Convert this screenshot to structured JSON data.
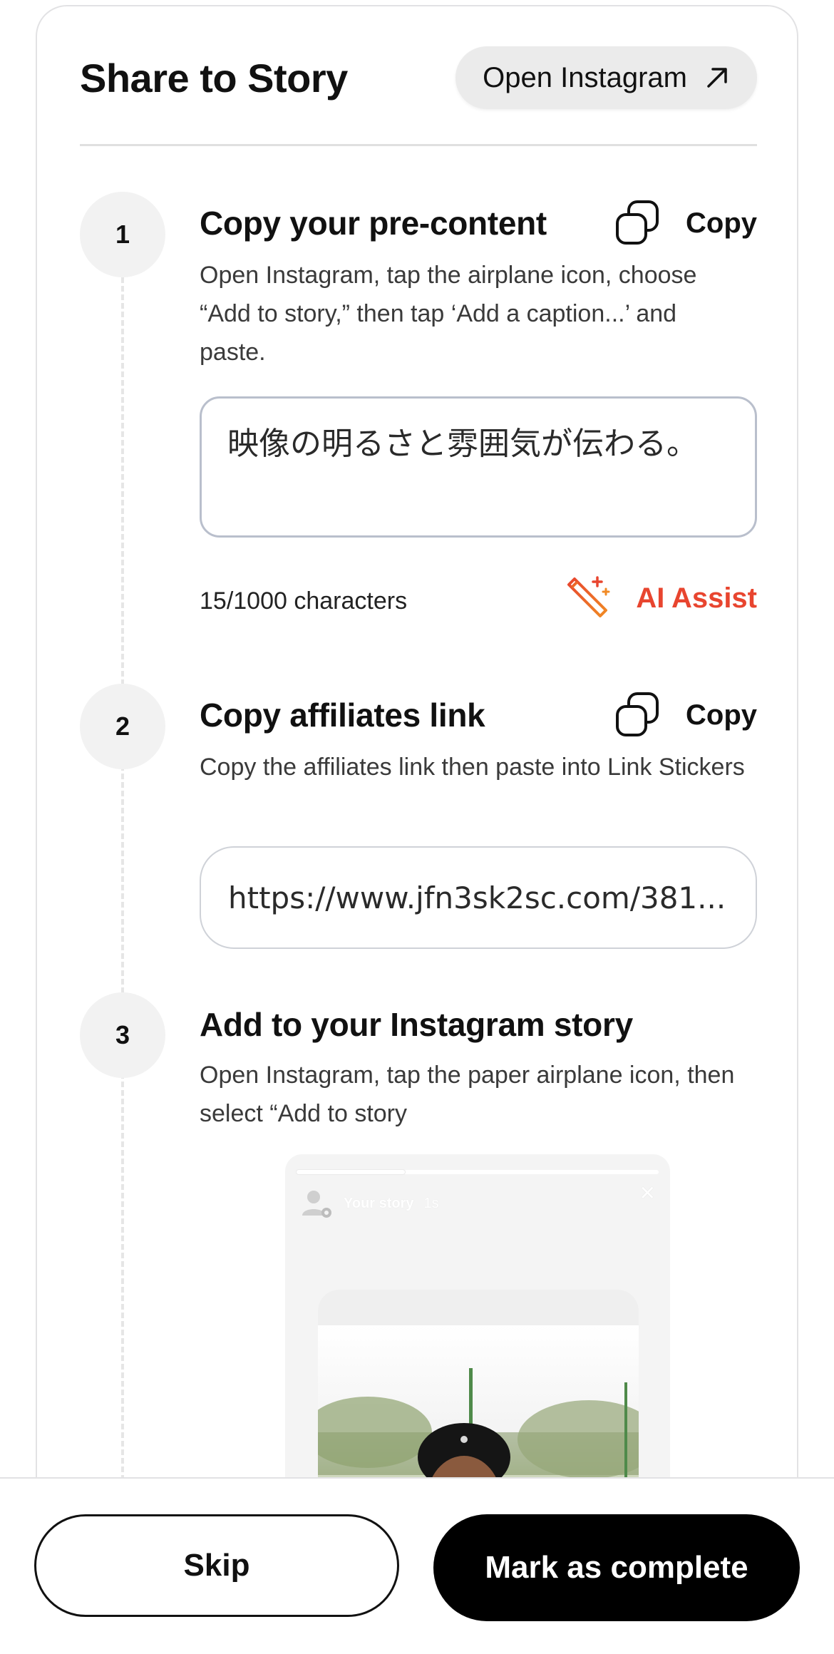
{
  "header": {
    "title": "Share to Story",
    "open_instagram_label": "Open Instagram"
  },
  "steps": [
    {
      "number": "1",
      "title": "Copy your pre-content",
      "copy_label": "Copy",
      "description": "Open Instagram, tap the airplane icon, choose “Add to story,” then tap ‘Add a caption...’ and paste.",
      "content_text": "映像の明るさと雰囲気が伝わる。",
      "char_count": "15/1000 characters",
      "ai_assist_label": "AI Assist"
    },
    {
      "number": "2",
      "title": "Copy affiliates link",
      "copy_label": "Copy",
      "description": "Copy the affiliates link then paste into Link Stickers",
      "link_value": "https://www.jfn3sk2sc.com/381..."
    },
    {
      "number": "3",
      "title": "Add to your Instagram story",
      "description": "Open Instagram, tap the paper airplane icon, then select “Add to story",
      "preview": {
        "user_label": "Your story",
        "time_label": "1s",
        "close_glyph": "✕",
        "progress": 0.3
      }
    }
  ],
  "footer": {
    "skip_label": "Skip",
    "complete_label": "Mark as complete"
  },
  "colors": {
    "accent_ai": "#e8452f",
    "primary_button": "#000000",
    "step_circle": "#f2f2f2"
  },
  "icons": {
    "open_instagram": "arrow-up-right-icon",
    "copy": "copy-icon",
    "ai_assist": "magic-wand-icon",
    "story_avatar": "user-settings-icon"
  }
}
